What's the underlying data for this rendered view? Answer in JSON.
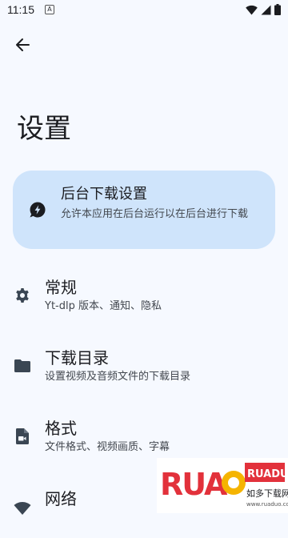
{
  "status_bar": {
    "time": "11:15",
    "notification_icon": "A",
    "icons": [
      "wifi-icon",
      "signal-icon",
      "battery-icon"
    ]
  },
  "header": {
    "back_icon": "arrow-back-icon"
  },
  "page": {
    "title": "设置"
  },
  "background_card": {
    "icon": "bolt-circle-icon",
    "title": "后台下载设置",
    "description": "允许本应用在后台运行以在后台进行下载"
  },
  "settings_items": [
    {
      "icon": "gear-icon",
      "title": "常规",
      "description": "Yt-dlp 版本、通知、隐私"
    },
    {
      "icon": "folder-icon",
      "title": "下载目录",
      "description": "设置视频及音频文件的下载目录"
    },
    {
      "icon": "video-file-icon",
      "title": "格式",
      "description": "文件格式、视频画质、字幕"
    },
    {
      "icon": "wifi-icon",
      "title": "网络",
      "description": ""
    }
  ],
  "watermark": {
    "brand": "RUANDAO",
    "tagline": "如多下载网",
    "url": "www.ruaduo.com"
  },
  "colors": {
    "background": "#f6f9ff",
    "card": "#cfe4fb",
    "text": "#1b1c20",
    "secondary_text": "#42474e",
    "icon": "#3a4653"
  }
}
